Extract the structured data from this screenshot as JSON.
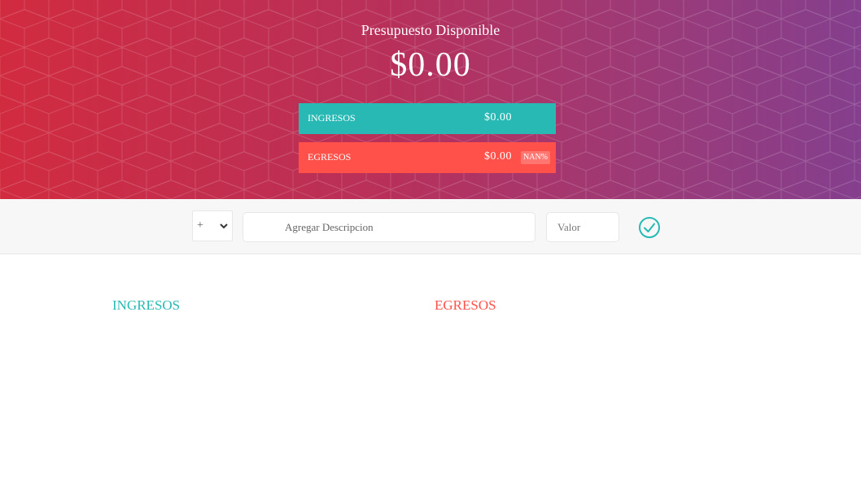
{
  "header": {
    "title": "Presupuesto Disponible",
    "total": "$0.00",
    "income": {
      "label": "INGRESOS",
      "value": "$0.00"
    },
    "expense": {
      "label": "EGRESOS",
      "value": "$0.00",
      "percentage": "NAN%"
    }
  },
  "add_form": {
    "type_selected": "+",
    "description_placeholder": "Agregar Descripcion",
    "value_placeholder": "Valor",
    "submit_icon": "check-circle-icon"
  },
  "lists": {
    "income_title": "INGRESOS",
    "expense_title": "EGRESOS"
  },
  "colors": {
    "income": "#28b9b5",
    "expense": "#ff5049",
    "gradient_start": "#d12b3f",
    "gradient_end": "#843f8d"
  }
}
